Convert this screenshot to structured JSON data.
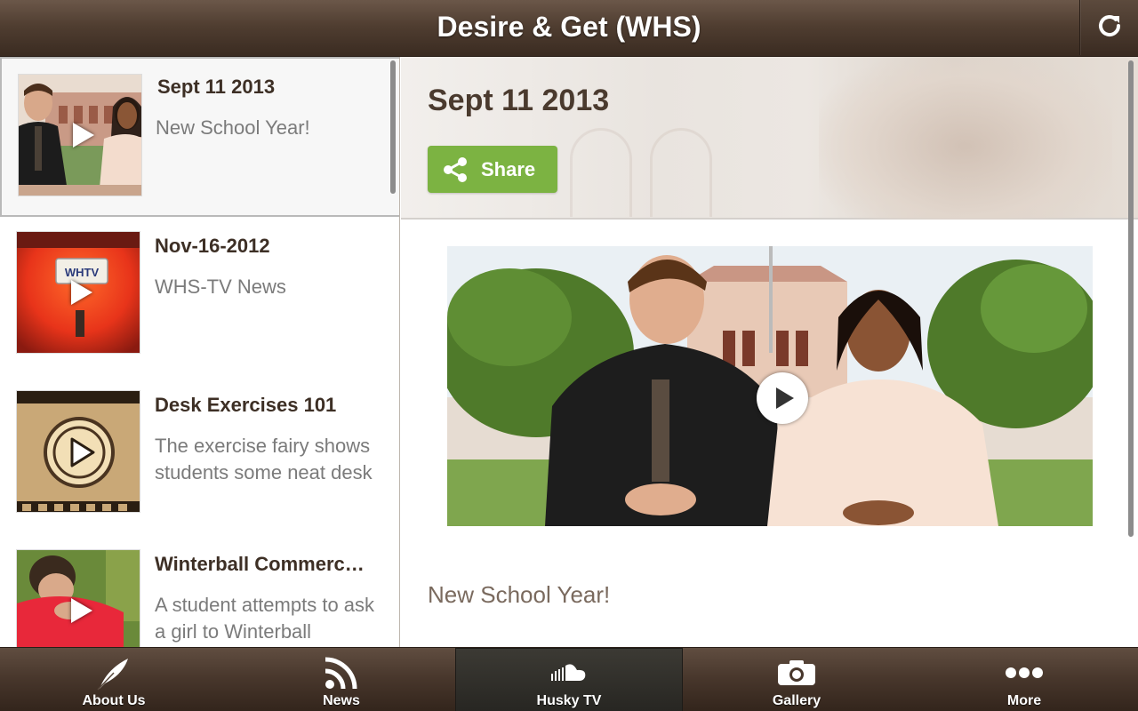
{
  "header": {
    "title": "Desire & Get (WHS)",
    "refresh_icon": "refresh-icon"
  },
  "list": {
    "items": [
      {
        "title": "Sept 11 2013",
        "description": "New School Year!",
        "thumbnail": "anchors-video-thumbnail",
        "selected": true
      },
      {
        "title": "Nov-16-2012",
        "description": "WHS-TV News",
        "thumbnail": "car-license-plate-thumbnail",
        "selected": false
      },
      {
        "title": "Desk Exercises 101",
        "description": "The exercise fairy shows students some neat desk",
        "thumbnail": "film-reel-thumbnail",
        "selected": false
      },
      {
        "title": "Winterball Commerc…",
        "description": "A student attempts to ask a girl to Winterball",
        "thumbnail": "student-red-shirt-thumbnail",
        "selected": false
      }
    ]
  },
  "detail": {
    "title": "Sept 11 2013",
    "share_label": "Share",
    "description": "New School Year!"
  },
  "tabs": [
    {
      "label": "About Us",
      "icon": "feather-icon",
      "active": false
    },
    {
      "label": "News",
      "icon": "rss-icon",
      "active": false
    },
    {
      "label": "Husky TV",
      "icon": "soundcloud-icon",
      "active": true
    },
    {
      "label": "Gallery",
      "icon": "camera-icon",
      "active": false
    },
    {
      "label": "More",
      "icon": "more-dots-icon",
      "active": false
    }
  ],
  "colors": {
    "header_brown": "#503e31",
    "share_green": "#7cb342",
    "title_brown": "#4a3a2e"
  }
}
